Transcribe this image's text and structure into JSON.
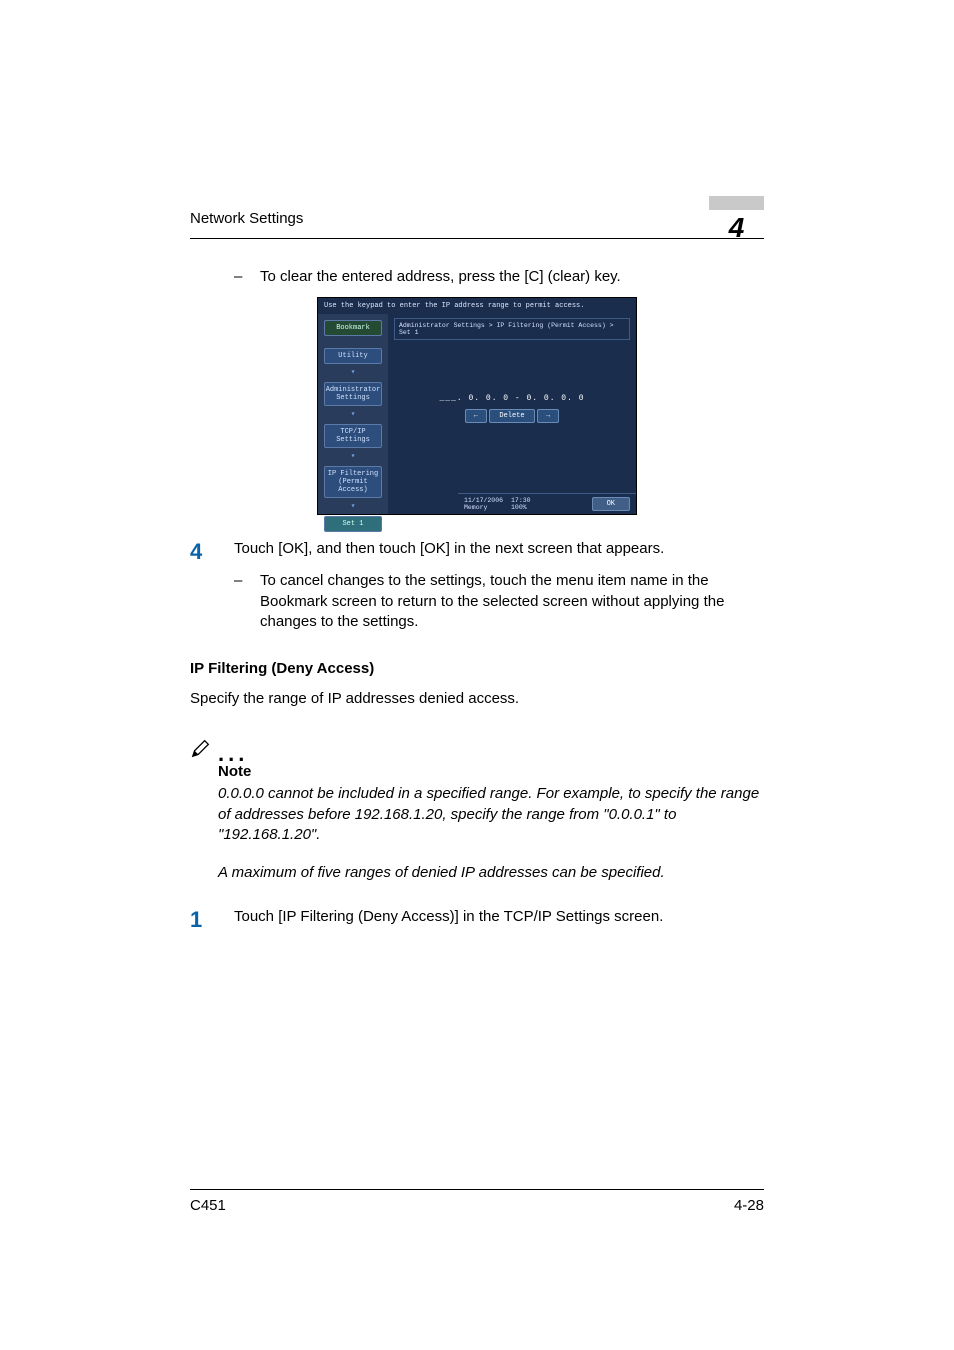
{
  "header": {
    "title": "Network Settings",
    "chapter": "4"
  },
  "step_clear": {
    "dash": "–",
    "text": "To clear the entered address, press the [C] (clear) key."
  },
  "screenshot": {
    "top_instruction": "Use the keypad to enter the IP address range to permit access.",
    "bookmark": "Bookmark",
    "nav": {
      "utility": "Utility",
      "admin": "Administrator Settings",
      "tcpip": "TCP/IP Settings",
      "ipfilter": "IP Filtering (Permit Access)",
      "set1": "Set 1"
    },
    "breadcrumb": "Administrator Settings > IP Filtering (Permit Access) > Set 1",
    "ip_line": "___.   0.   0.   0  -   0.   0.   0.   0",
    "btn_left": "←",
    "btn_delete": "Delete",
    "btn_right": "→",
    "footer": {
      "date": "11/17/2006",
      "time": "17:30",
      "memory_label": "Memory",
      "memory_value": "100%",
      "ok": "OK"
    }
  },
  "step4": {
    "num": "4",
    "text": "Touch [OK], and then touch [OK] in the next screen that appears.",
    "sub_dash": "–",
    "sub_text": "To cancel changes to the settings, touch the menu item name in the Bookmark screen to return to the selected screen without applying the changes to the settings."
  },
  "section": {
    "heading": "IP Filtering (Deny Access)",
    "para": "Specify the range of IP addresses denied access."
  },
  "note": {
    "label": "Note",
    "body1": "0.0.0.0 cannot be included in a specified range. For example, to specify the range of addresses before 192.168.1.20, specify the range from \"0.0.0.1\" to \"192.168.1.20\".",
    "body2": "A maximum of five ranges of denied IP addresses can be specified."
  },
  "step1": {
    "num": "1",
    "text": "Touch [IP Filtering (Deny Access)] in the TCP/IP Settings screen."
  },
  "footer": {
    "model": "C451",
    "page": "4-28"
  }
}
